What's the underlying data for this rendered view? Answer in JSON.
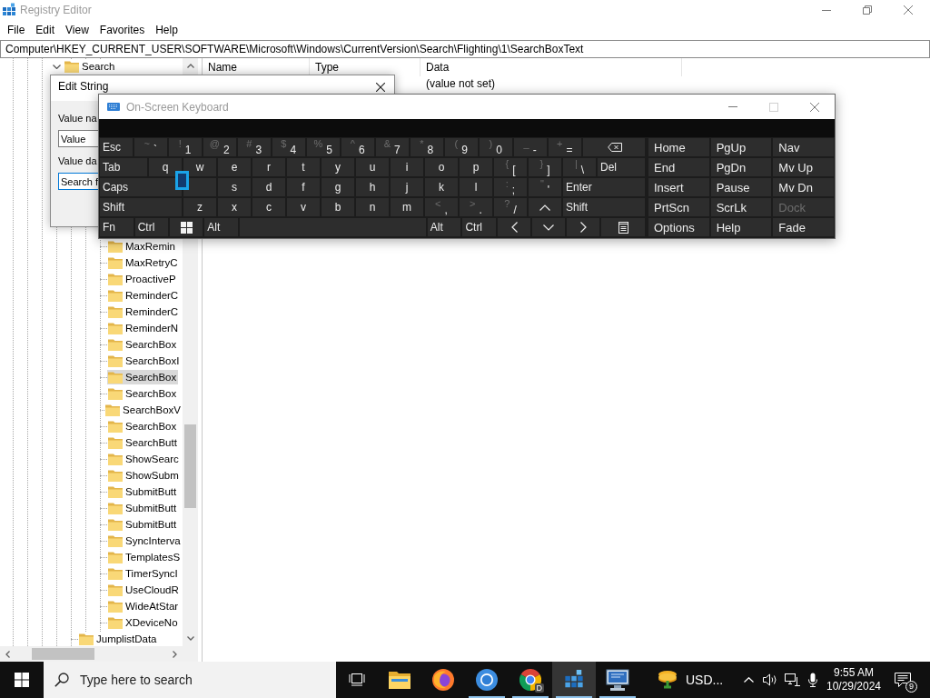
{
  "window": {
    "title": "Registry Editor"
  },
  "menu": [
    "File",
    "Edit",
    "View",
    "Favorites",
    "Help"
  ],
  "address": "Computer\\HKEY_CURRENT_USER\\SOFTWARE\\Microsoft\\Windows\\CurrentVersion\\Search\\Flighting\\1\\SearchBoxText",
  "tree": [
    {
      "label": "Search",
      "expanded": true,
      "selected": false,
      "children": [
        {
          "children": [
            {
              "children": [
                {
                  "label": "MaxRemin",
                  "selected": false
                },
                {
                  "label": "MaxRetryC",
                  "selected": false
                },
                {
                  "label": "ProactiveP",
                  "selected": false
                },
                {
                  "label": "ReminderC",
                  "selected": false
                },
                {
                  "label": "ReminderC",
                  "selected": false
                },
                {
                  "label": "ReminderN",
                  "selected": false
                },
                {
                  "label": "SearchBox",
                  "selected": false
                },
                {
                  "label": "SearchBoxI",
                  "selected": false
                },
                {
                  "label": "SearchBox",
                  "selected": true
                },
                {
                  "label": "SearchBox",
                  "selected": false
                },
                {
                  "label": "SearchBoxV",
                  "selected": false
                },
                {
                  "label": "SearchBox",
                  "selected": false
                },
                {
                  "label": "SearchButt",
                  "selected": false
                },
                {
                  "label": "ShowSearc",
                  "selected": false
                },
                {
                  "label": "ShowSubm",
                  "selected": false
                },
                {
                  "label": "SubmitButt",
                  "selected": false
                },
                {
                  "label": "SubmitButt",
                  "selected": false
                },
                {
                  "label": "SubmitButt",
                  "selected": false
                },
                {
                  "label": "SyncInterva",
                  "selected": false
                },
                {
                  "label": "TemplatesS",
                  "selected": false
                },
                {
                  "label": "TimerSyncI",
                  "selected": false
                },
                {
                  "label": "UseCloudR",
                  "selected": false
                },
                {
                  "label": "WideAtStar",
                  "selected": false
                },
                {
                  "label": "XDeviceNo",
                  "selected": false
                }
              ]
            }
          ]
        },
        {
          "label": "JumplistData",
          "selected": false
        }
      ]
    }
  ],
  "list": {
    "columns": [
      "Name",
      "Type",
      "Data"
    ],
    "rows": [
      {
        "data": "(value not set)"
      }
    ]
  },
  "dialog": {
    "title": "Edit String",
    "fields": [
      {
        "label": "Value na",
        "value": "Value",
        "focused": false
      },
      {
        "label": "Value da",
        "value": "Search f",
        "focused": true
      }
    ]
  },
  "keyboard": {
    "title": "On-Screen Keyboard",
    "keys": [
      [
        {
          "kind": "text",
          "label": "Esc"
        },
        {
          "kind": "char",
          "shift": "~",
          "label": "`"
        },
        {
          "kind": "char",
          "shift": "!",
          "label": "1"
        },
        {
          "kind": "char",
          "shift": "@",
          "label": "2"
        },
        {
          "kind": "char",
          "shift": "#",
          "label": "3"
        },
        {
          "kind": "char",
          "shift": "$",
          "label": "4"
        },
        {
          "kind": "char",
          "shift": "%",
          "label": "5"
        },
        {
          "kind": "char",
          "shift": "^",
          "label": "6"
        },
        {
          "kind": "char",
          "shift": "&",
          "label": "7"
        },
        {
          "kind": "char",
          "shift": "*",
          "label": "8"
        },
        {
          "kind": "char",
          "shift": "(",
          "label": "9"
        },
        {
          "kind": "char",
          "shift": ")",
          "label": "0"
        },
        {
          "kind": "char",
          "shift": "_",
          "label": "-"
        },
        {
          "kind": "char",
          "shift": "+",
          "label": "="
        },
        {
          "kind": "backspace"
        }
      ],
      [
        {
          "kind": "text",
          "label": "Tab"
        },
        {
          "kind": "char",
          "label": "q"
        },
        {
          "kind": "char",
          "label": "w"
        },
        {
          "kind": "char",
          "label": "e"
        },
        {
          "kind": "char",
          "label": "r"
        },
        {
          "kind": "char",
          "label": "t"
        },
        {
          "kind": "char",
          "label": "y"
        },
        {
          "kind": "char",
          "label": "u"
        },
        {
          "kind": "char",
          "label": "i"
        },
        {
          "kind": "char",
          "label": "o"
        },
        {
          "kind": "char",
          "label": "p"
        },
        {
          "kind": "char",
          "shift": "{",
          "label": "["
        },
        {
          "kind": "char",
          "shift": "}",
          "label": "]"
        },
        {
          "kind": "char",
          "shift": "|",
          "label": "\\"
        },
        {
          "kind": "text",
          "label": "Del"
        }
      ],
      [
        {
          "kind": "text",
          "label": "Caps"
        },
        {
          "kind": "char"
        },
        {
          "kind": "char",
          "label": "s"
        },
        {
          "kind": "char",
          "label": "d"
        },
        {
          "kind": "char",
          "label": "f"
        },
        {
          "kind": "char",
          "label": "g"
        },
        {
          "kind": "char",
          "label": "h"
        },
        {
          "kind": "char",
          "label": "j"
        },
        {
          "kind": "char",
          "label": "k"
        },
        {
          "kind": "char",
          "label": "l"
        },
        {
          "kind": "char",
          "shift": ":",
          "label": ";"
        },
        {
          "kind": "char",
          "shift": "\"",
          "label": "'"
        },
        {
          "kind": "text",
          "label": "Enter"
        }
      ],
      [
        {
          "kind": "text",
          "label": "Shift"
        },
        {
          "kind": "char",
          "label": "z"
        },
        {
          "kind": "char",
          "label": "x"
        },
        {
          "kind": "char",
          "label": "c"
        },
        {
          "kind": "char",
          "label": "v"
        },
        {
          "kind": "char",
          "label": "b"
        },
        {
          "kind": "char",
          "label": "n"
        },
        {
          "kind": "char",
          "label": "m"
        },
        {
          "kind": "char",
          "shift": "<",
          "label": ","
        },
        {
          "kind": "char",
          "shift": ">",
          "label": "."
        },
        {
          "kind": "char",
          "shift": "?",
          "label": "/"
        },
        {
          "kind": "up"
        },
        {
          "kind": "text",
          "label": "Shift"
        }
      ],
      [
        {
          "kind": "text",
          "label": "Fn"
        },
        {
          "kind": "text",
          "label": "Ctrl"
        },
        {
          "kind": "win"
        },
        {
          "kind": "text",
          "label": "Alt"
        },
        {
          "kind": "space"
        },
        {
          "kind": "text",
          "label": "Alt"
        },
        {
          "kind": "text",
          "label": "Ctrl"
        },
        {
          "kind": "left"
        },
        {
          "kind": "down"
        },
        {
          "kind": "right"
        },
        {
          "kind": "menu"
        }
      ]
    ],
    "side_keys": [
      [
        {
          "label": "Home",
          "disabled": false
        },
        {
          "label": "PgUp",
          "disabled": false
        },
        {
          "label": "Nav",
          "disabled": false
        }
      ],
      [
        {
          "label": "End",
          "disabled": false
        },
        {
          "label": "PgDn",
          "disabled": false
        },
        {
          "label": "Mv Up",
          "disabled": false
        }
      ],
      [
        {
          "label": "Insert",
          "disabled": false
        },
        {
          "label": "Pause",
          "disabled": false
        },
        {
          "label": "Mv Dn",
          "disabled": false
        }
      ],
      [
        {
          "label": "PrtScn",
          "disabled": false
        },
        {
          "label": "ScrLk",
          "disabled": false
        },
        {
          "label": "Dock",
          "disabled": true
        }
      ],
      [
        {
          "label": "Options",
          "disabled": false
        },
        {
          "label": "Help",
          "disabled": false
        },
        {
          "label": "Fade",
          "disabled": false
        }
      ]
    ]
  },
  "taskbar": {
    "search": {
      "placeholder": "Type here to search"
    },
    "apps": [
      {
        "running": false,
        "selected": false
      },
      {
        "running": false,
        "selected": false
      },
      {
        "running": true,
        "selected": false
      },
      {
        "badge": "D",
        "running": true,
        "selected": false
      },
      {
        "running": true,
        "selected": true
      },
      {
        "running": true,
        "selected": false
      },
      {
        "label": "USD...",
        "running": false,
        "selected": false
      }
    ],
    "clock": {
      "time": "9:55 AM",
      "date": "10/29/2024"
    },
    "notifications": "9"
  }
}
